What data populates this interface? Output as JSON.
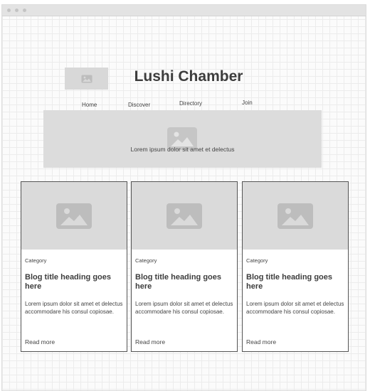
{
  "brand": {
    "name": "Lushi Chamber",
    "logo_icon": "image-placeholder-icon"
  },
  "nav": {
    "items": [
      "Home",
      "Discover",
      "Directory",
      "Join"
    ]
  },
  "hero": {
    "text": "Lorem ipsum dolor sit amet et delectus",
    "icon": "image-placeholder-icon"
  },
  "cards": [
    {
      "category": "Category",
      "heading": "Blog title heading goes here",
      "body": "Lorem ipsum dolor sit amet et delectus accommodare his consul copiosae.",
      "link": "Read more",
      "icon": "image-placeholder-icon"
    },
    {
      "category": "Category",
      "heading": "Blog title heading goes here",
      "body": "Lorem ipsum dolor sit amet et delectus accommodare his consul copiosae.",
      "link": "Read more",
      "icon": "image-placeholder-icon"
    },
    {
      "category": "Category",
      "heading": "Blog title heading goes here",
      "body": "Lorem ipsum dolor sit amet et delectus accommodare his consul copiosae.",
      "link": "Read more",
      "icon": "image-placeholder-icon"
    }
  ],
  "colors": {
    "placeholder": "#dadada",
    "placeholder_icon": "#bdbdbd",
    "grid": "#ececec",
    "text": "#444444"
  }
}
